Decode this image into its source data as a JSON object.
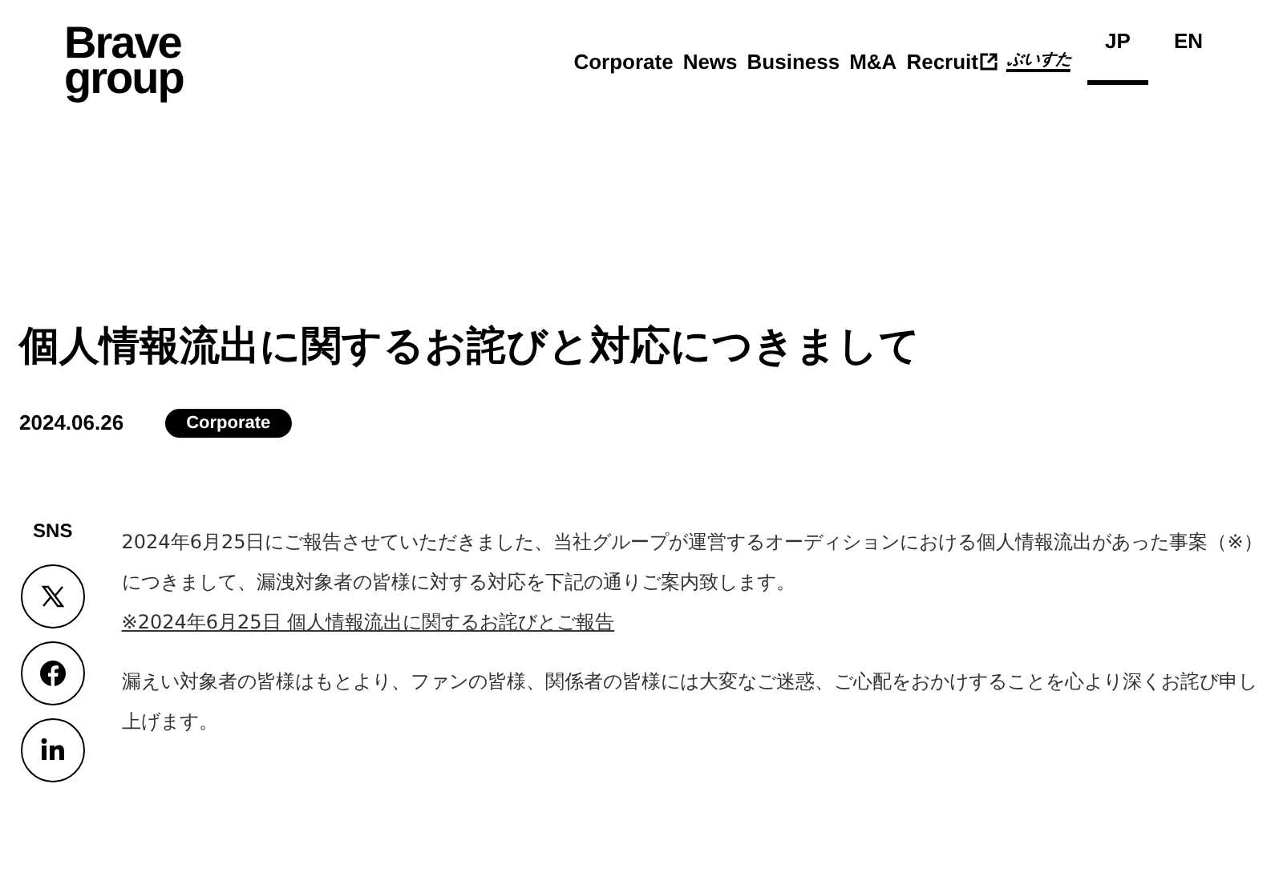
{
  "logo": {
    "line_1": "Brave",
    "line_2": "group"
  },
  "nav": [
    {
      "label": "Corporate",
      "external": false
    },
    {
      "label": "News",
      "external": false
    },
    {
      "label": "Business",
      "external": false
    },
    {
      "label": "M&A",
      "external": false
    },
    {
      "label": "Recruit",
      "external": true
    }
  ],
  "nav_logo": "ぶいすた",
  "languages": [
    {
      "label": "JP",
      "selected": true
    },
    {
      "label": "EN",
      "selected": false
    }
  ],
  "article": {
    "title": "個人情報流出に関するお詫びと対応につきまして",
    "date": "2024.06.26",
    "category": "Corporate"
  },
  "sns": {
    "label": "SNS",
    "buttons": [
      {
        "kind": "x"
      },
      {
        "kind": "facebook"
      },
      {
        "kind": "linkedin"
      }
    ]
  },
  "body": [
    {
      "kind": "text",
      "text": "2024年6月25日にご報告させていただきました、当社グループが運営するオーディションにおける個人情報流出があった事案（※）につきまして、漏洩対象者の皆様に対する対応を下記の通りご案内致します。"
    },
    {
      "kind": "link",
      "text": "※2024年6月25日 個人情報流出に関するお詫びとご報告"
    },
    {
      "kind": "text",
      "text": "漏えい対象者の皆様はもとより、ファンの皆様、関係者の皆様には大変なご迷惑、ご心配をおかけすることを心より深くお詫び申し上げます。"
    }
  ]
}
